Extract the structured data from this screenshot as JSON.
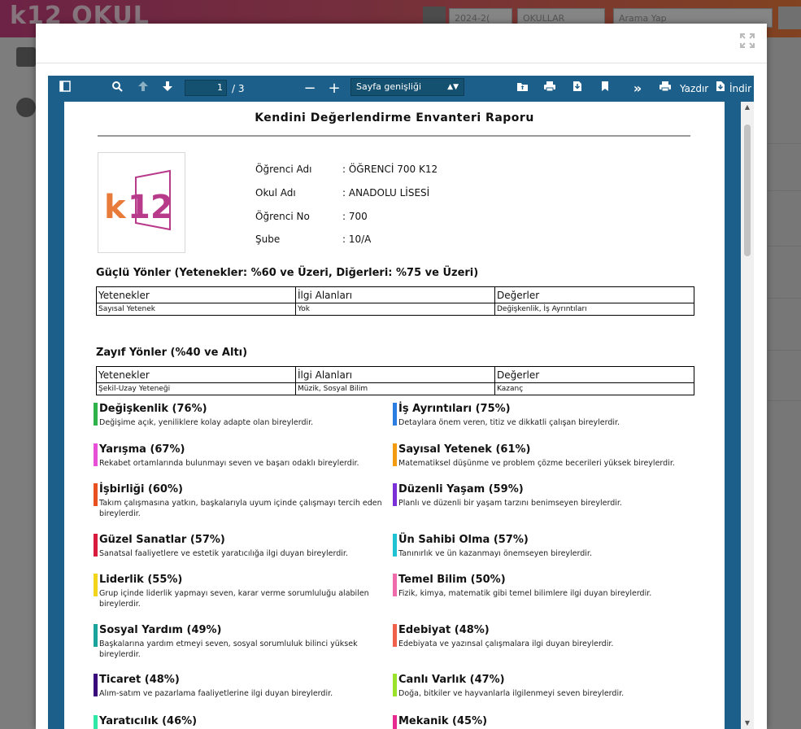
{
  "background": {
    "logo_text": "k12 OKUL",
    "year_select": "2024-2(",
    "school_select": "OKULLAR",
    "search_placeholder": "Arama Yap"
  },
  "viewer": {
    "page_current": "1",
    "page_total": "/ 3",
    "zoom_label": "Sayfa genişliği",
    "print_label": "Yazdır",
    "download_label": "İndir"
  },
  "report": {
    "title": "Kendini Değerlendirme Envanteri Raporu",
    "logo_text": "k12",
    "info": [
      {
        "label": "Öğrenci Adı",
        "value": ": ÖĞRENCİ 700 K12"
      },
      {
        "label": "Okul Adı",
        "value": ": ANADOLU LİSESİ"
      },
      {
        "label": "Öğrenci No",
        "value": ": 700"
      },
      {
        "label": "Şube",
        "value": ": 10/A"
      }
    ],
    "strong": {
      "title": "Güçlü Yönler (Yetenekler: %60 ve Üzeri, Diğerleri: %75 ve Üzeri)",
      "headers": [
        "Yetenekler",
        "İlgi Alanları",
        "Değerler"
      ],
      "row": [
        "Sayısal Yetenek",
        "Yok",
        "Değişkenlik, İş Ayrıntıları"
      ]
    },
    "weak": {
      "title": "Zayıf Yönler (%40 ve Altı)",
      "headers": [
        "Yetenekler",
        "İlgi Alanları",
        "Değerler"
      ],
      "row": [
        "Şekil-Uzay Yeteneği",
        "Müzik, Sosyal Bilim",
        "Kazanç"
      ]
    },
    "traits": [
      {
        "name": "Değişkenlik (76%)",
        "desc": "Değişime açık, yeniliklere kolay adapte olan bireylerdir.",
        "color": "#2db34a"
      },
      {
        "name": "İş Ayrıntıları (75%)",
        "desc": "Detaylara önem veren, titiz ve dikkatli çalışan bireylerdir.",
        "color": "#2a7de1"
      },
      {
        "name": "Yarışma (67%)",
        "desc": "Rekabet ortamlarında bulunmayı seven ve başarı odaklı bireylerdir.",
        "color": "#e84fd7"
      },
      {
        "name": "Sayısal Yetenek (61%)",
        "desc": "Matematiksel düşünme ve problem çözme becerileri yüksek bireylerdir.",
        "color": "#f39c12"
      },
      {
        "name": "İşbirliği (60%)",
        "desc": "Takım çalışmasına yatkın, başkalarıyla uyum içinde çalışmayı tercih eden bireylerdir.",
        "color": "#e8501f"
      },
      {
        "name": "Düzenli Yaşam (59%)",
        "desc": "Planlı ve düzenli bir yaşam tarzını benimseyen bireylerdir.",
        "color": "#7b2fd6"
      },
      {
        "name": "Güzel Sanatlar (57%)",
        "desc": "Sanatsal faaliyetlere ve estetik yaratıcılığa ilgi duyan bireylerdir.",
        "color": "#d81b3c"
      },
      {
        "name": "Ün Sahibi Olma (57%)",
        "desc": "Tanınırlık ve ün kazanmayı önemseyen bireylerdir.",
        "color": "#1fc3d1"
      },
      {
        "name": "Liderlik (55%)",
        "desc": "Grup içinde liderlik yapmayı seven, karar verme sorumluluğu alabilen bireylerdir.",
        "color": "#f2d51b"
      },
      {
        "name": "Temel Bilim (50%)",
        "desc": "Fizik, kimya, matematik gibi temel bilimlere ilgi duyan bireylerdir.",
        "color": "#f06bab"
      },
      {
        "name": "Sosyal Yardım (49%)",
        "desc": "Başkalarına yardım etmeyi seven, sosyal sorumluluk bilinci yüksek bireylerdir.",
        "color": "#1aa39a"
      },
      {
        "name": "Edebiyat (48%)",
        "desc": "Edebiyata ve yazınsal çalışmalara ilgi duyan bireylerdir.",
        "color": "#f0604a"
      },
      {
        "name": "Ticaret (48%)",
        "desc": "Alım-satım ve pazarlama faaliyetlerine ilgi duyan bireylerdir.",
        "color": "#3a0a7a"
      },
      {
        "name": "Canlı Varlık (47%)",
        "desc": "Doğa, bitkiler ve hayvanlarla ilgilenmeyi seven bireylerdir.",
        "color": "#9be22a"
      },
      {
        "name": "Yaratıcılık (46%)",
        "desc": "",
        "color": "#2ee8a8"
      },
      {
        "name": "Mekanik (45%)",
        "desc": "",
        "color": "#e62a8f"
      }
    ]
  }
}
